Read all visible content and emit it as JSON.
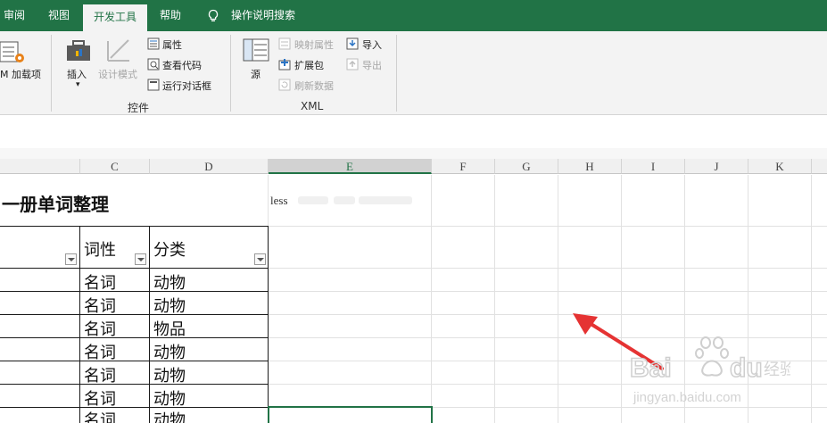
{
  "ribbon_tabs": [
    {
      "label": "审阅"
    },
    {
      "label": "视图"
    },
    {
      "label": "开发工具"
    },
    {
      "label": "帮助"
    },
    {
      "label": "操作说明搜索"
    }
  ],
  "ribbon": {
    "addins": {
      "label": "M 加载项"
    },
    "controls": {
      "insert": "插入",
      "design_mode": "设计模式",
      "properties": "属性",
      "view_code": "查看代码",
      "run_dialog": "运行对话框",
      "group_label": "控件"
    },
    "xml": {
      "source": "源",
      "map_properties": "映射属性",
      "expansion_packs": "扩展包",
      "refresh_data": "刷新数据",
      "import": "导入",
      "export": "导出",
      "group_label": "XML"
    }
  },
  "columns": [
    "C",
    "D",
    "E",
    "F",
    "G",
    "H",
    "I",
    "J",
    "K"
  ],
  "sheet": {
    "title": "一册单词整理",
    "header_pos": "词性",
    "header_cat": "分类",
    "e1_text": "less",
    "rows": [
      {
        "pos": "名词",
        "cat": "动物"
      },
      {
        "pos": "名词",
        "cat": "动物"
      },
      {
        "pos": "名词",
        "cat": "物品"
      },
      {
        "pos": "名词",
        "cat": "动物"
      },
      {
        "pos": "名词",
        "cat": "动物"
      },
      {
        "pos": "名词",
        "cat": "动物"
      },
      {
        "pos": "名词",
        "cat": "动物"
      }
    ]
  },
  "colors": {
    "accent": "#217346",
    "arrow": "#e53333"
  },
  "watermark": {
    "brand": "Baidu经验",
    "url": "jingyan.baidu.com"
  }
}
